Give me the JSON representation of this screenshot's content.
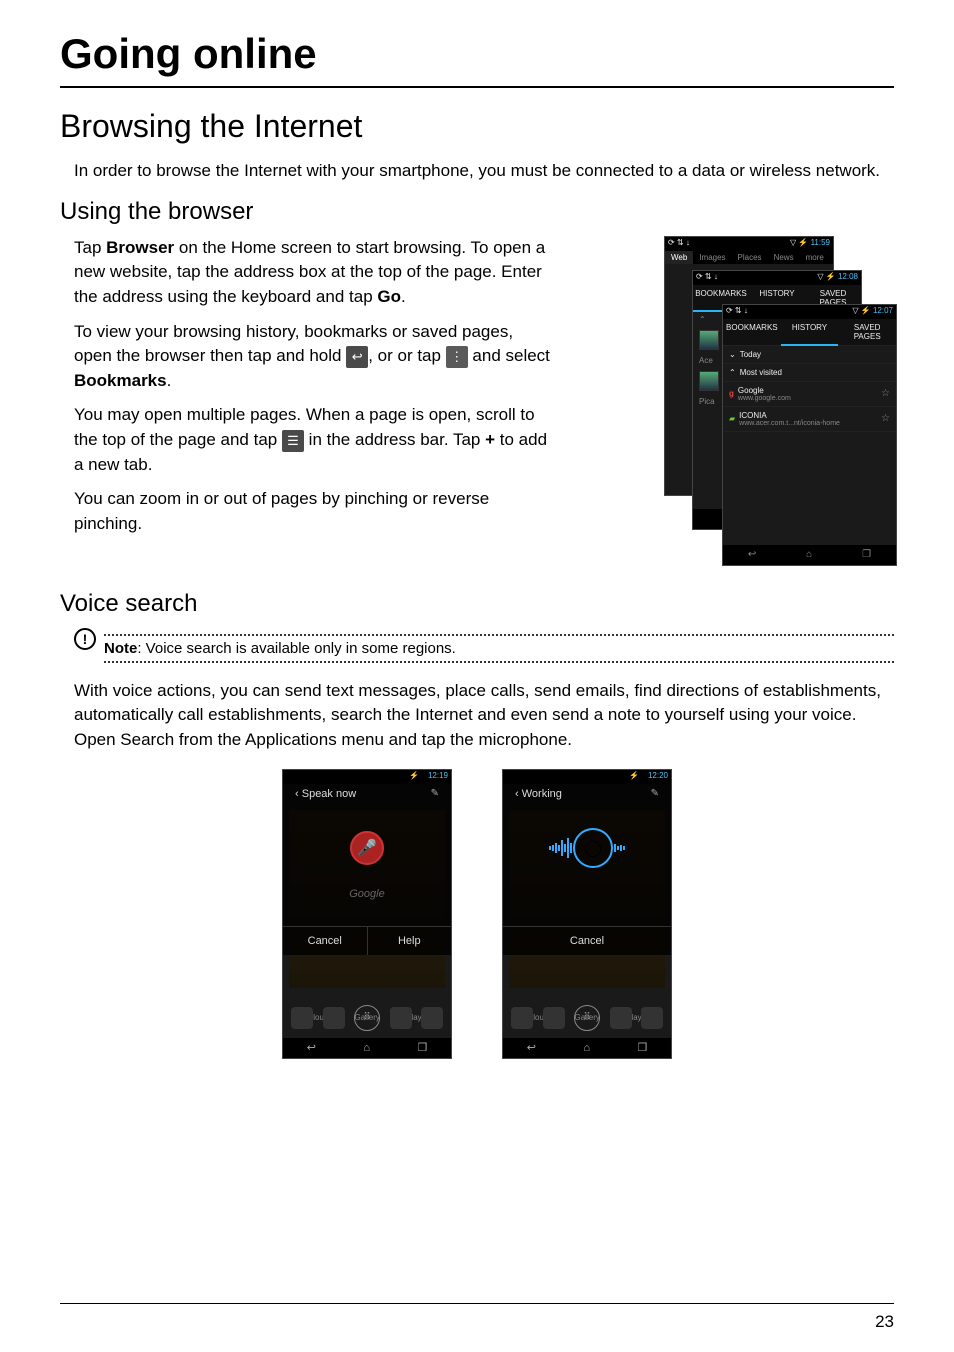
{
  "chapter_title": "Going online",
  "section_title": "Browsing the Internet",
  "p_intro": "In order to browse the Internet with your smartphone, you must be connected to a data or wireless network.",
  "s1_title": "Using the browser",
  "s1_p1a": "Tap ",
  "s1_p1_bold": "Browser",
  "s1_p1b": " on the Home screen to start browsing. To open a new website, tap the address box at the top of the page. Enter the address using the keyboard and tap ",
  "s1_p1_go": "Go",
  "s1_p1c": ".",
  "s1_p2a": "To view your browsing history, bookmarks or saved pages, open the browser then tap and hold ",
  "s1_p2b": ", or or tap ",
  "s1_p2c": " and select ",
  "s1_p2_bm": "Bookmarks",
  "s1_p2d": ".",
  "s1_p3a": "You may open multiple pages. When a page is open, scroll to the top of the page and tap ",
  "s1_p3b": " in the address bar. Tap ",
  "s1_p3_plus": "+",
  "s1_p3c": " to add a new tab.",
  "s1_p4": "You can zoom in or out of pages by pinching or reverse pinching.",
  "s2_title": "Voice search",
  "note_label": "Note",
  "note_text": ": Voice search is available only in some regions.",
  "s2_p1": "With voice actions, you can send text messages, place calls, send emails, find directions of establishments, automatically call establishments, search the Internet and even send a note to yourself using your voice. Open Search from the Applications menu and tap the microphone.",
  "page_number": "23",
  "browser_mock": {
    "status_left": "⟳ ⇅ ↓",
    "status_right_pre": "▽ ⚡",
    "time1": "11:59",
    "time2": "12:08",
    "time3": "12:07",
    "top_tabs": [
      "Web",
      "Images",
      "Places",
      "News",
      "more"
    ],
    "page_tabs": [
      "BOOKMARKS",
      "HISTORY",
      "SAVED PAGES"
    ],
    "today": "Today",
    "most_visited": "Most visited",
    "ace": "Ace",
    "pica": "Pica",
    "items": [
      {
        "name": "Google",
        "sub": "www.google.com"
      },
      {
        "name": "ICONIA",
        "sub": "www.acer.com.t...nt/iconia-home"
      }
    ]
  },
  "voice_mock": {
    "status_left": "⟳ ↓",
    "status_right": "▽ ⚡ ▮",
    "time1": "12:19",
    "time2": "12:20",
    "speak_now": "Speak now",
    "working": "Working",
    "google": "Google",
    "cancel": "Cancel",
    "help": "Help",
    "acercloud": "AcerCloud",
    "gallery": "Gallery",
    "playstore": "Play Store"
  }
}
